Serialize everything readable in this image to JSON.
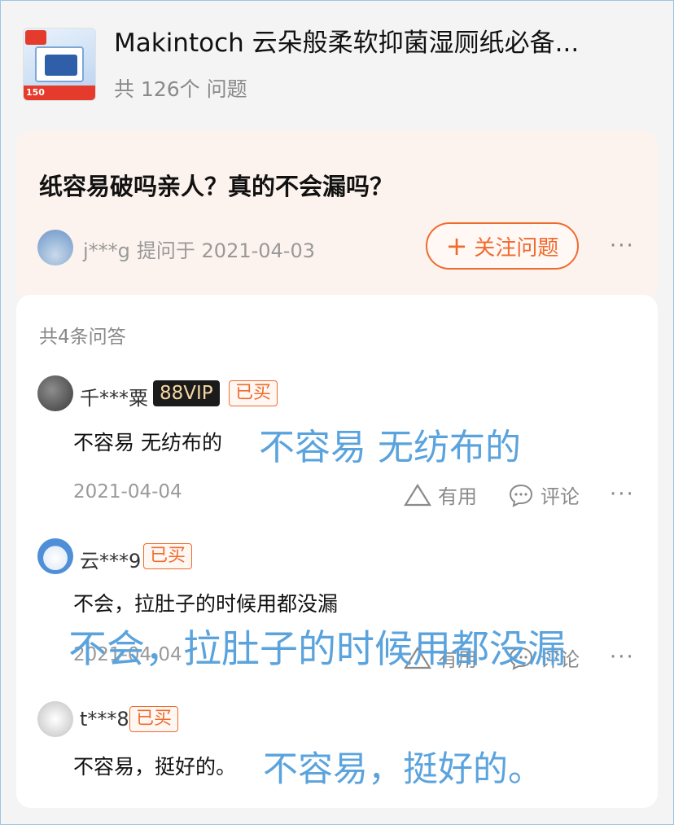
{
  "product": {
    "title": "Makintoch 云朵般柔软抑菌湿厕纸必备...",
    "question_count": "共 126个 问题",
    "thumb_price": "150"
  },
  "question": {
    "text": "纸容易破吗亲人？真的不会漏吗？",
    "asker": "j***g",
    "asked_label": "提问于 2021-04-03",
    "follow_label": "关注问题",
    "more": "···"
  },
  "answers": {
    "count_label": "共4条问答",
    "items": [
      {
        "user": "千***粟",
        "vip": "88VIP",
        "bought": "已买",
        "text": "不容易 无纺布的",
        "overlay": "不容易 无纺布的",
        "date": "2021-04-04",
        "useful": "有用",
        "comment": "评论",
        "more": "···"
      },
      {
        "user": "云***9",
        "bought": "已买",
        "text": "不会，拉肚子的时候用都没漏",
        "overlay": "不会，拉肚子的时候用都没漏",
        "date": "2021-04-04",
        "useful": "有用",
        "comment": "评论",
        "more": "···"
      },
      {
        "user": "t***8",
        "bought": "已买",
        "text": "不容易，挺好的。",
        "overlay": "不容易，挺好的。"
      }
    ]
  },
  "colors": {
    "accent": "#f06a2e",
    "overlay_text": "#5aa3dd",
    "question_bg": "#fdf3ee"
  }
}
